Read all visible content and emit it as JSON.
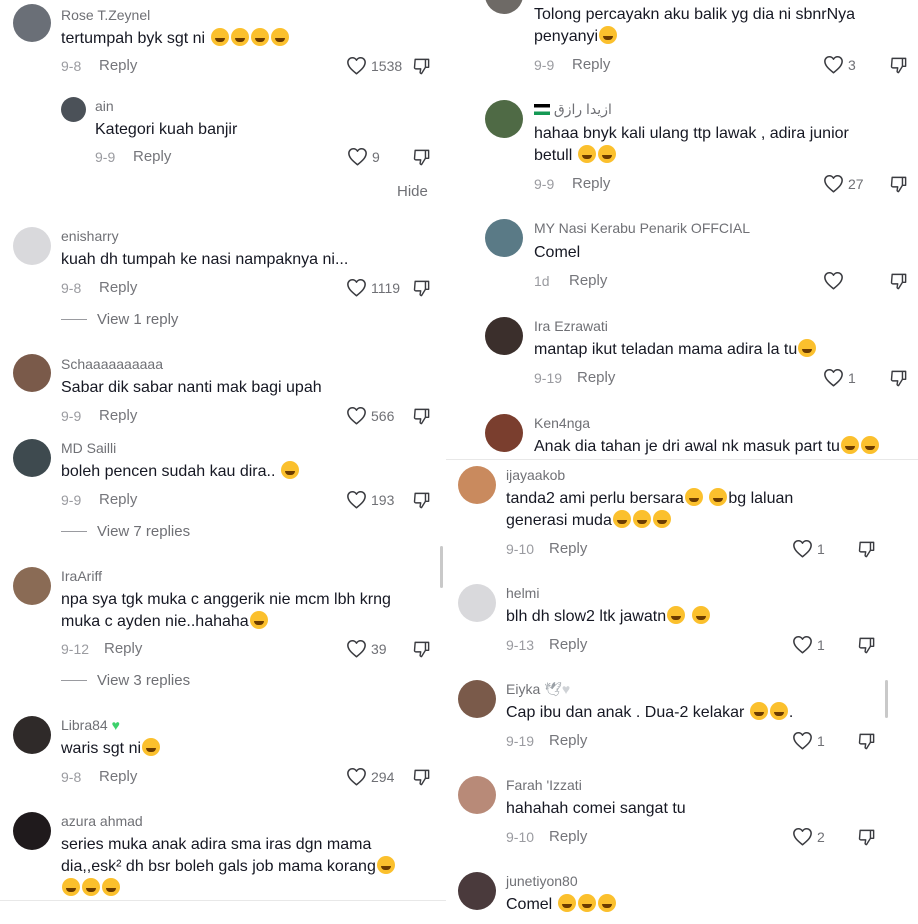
{
  "left": {
    "comments": [
      {
        "user": "Rose T.Zeynel",
        "text": "tertumpah byk sgt ni",
        "emojis": 4,
        "date": "9-8",
        "reply": "Reply",
        "likes": "1538"
      },
      {
        "user": "ain",
        "text": "Kategori kuah banjir",
        "date": "9-9",
        "reply": "Reply",
        "likes": "9"
      },
      {
        "user": "enisharry",
        "text": "kuah dh tumpah ke nasi nampaknya ni...",
        "date": "9-8",
        "reply": "Reply",
        "likes": "1119",
        "view": "View 1 reply"
      },
      {
        "user": "Schaaaaaaaaaa",
        "text": "Sabar dik sabar nanti mak bagi upah",
        "date": "9-9",
        "reply": "Reply",
        "likes": "566"
      },
      {
        "user": "MD Sailli",
        "text": "boleh pencen sudah kau dira..",
        "date": "9-9",
        "reply": "Reply",
        "likes": "193",
        "view": "View 7 replies"
      },
      {
        "user": "IraAriff",
        "text1": "npa sya tgk muka c anggerik nie mcm lbh krng",
        "text2": "muka c ayden nie..hahaha",
        "date": "9-12",
        "reply": "Reply",
        "likes": "39",
        "view": "View 3 replies"
      },
      {
        "user": "Libra84",
        "text": "waris sgt ni",
        "date": "9-8",
        "reply": "Reply",
        "likes": "294"
      },
      {
        "user": "azura ahmad",
        "text1": "series muka anak adira sma iras dgn mama",
        "text2": "dia,,esk² dh bsr boleh gals job mama korang"
      }
    ],
    "hide": "Hide"
  },
  "right1": {
    "comments": [
      {
        "text1": "Tolong percayakn aku balik yg dia ni sbnrNya",
        "text2": "penyanyi",
        "date": "9-9",
        "reply": "Reply",
        "likes": "3"
      },
      {
        "user": "ازيدا رازق",
        "text1": "hahaa bnyk kali ulang ttp lawak , adira junior",
        "text2": "betull",
        "date": "9-9",
        "reply": "Reply",
        "likes": "27"
      },
      {
        "user": "MY Nasi Kerabu Penarik OFFCIAL",
        "text": "Comel",
        "date": "1d",
        "reply": "Reply",
        "likes": ""
      },
      {
        "user": "Ira Ezrawati",
        "text": "mantap ikut teladan mama adira la tu",
        "date": "9-19",
        "reply": "Reply",
        "likes": "1"
      },
      {
        "user": "Ken4nga",
        "text": "Anak dia tahan je dri awal nk masuk part tu"
      }
    ]
  },
  "right2": {
    "comments": [
      {
        "user": "ijayaakob",
        "text1": "tanda2 ami perlu bersara",
        "text1b": "bg laluan",
        "text2": "generasi muda",
        "date": "9-10",
        "reply": "Reply",
        "likes": "1"
      },
      {
        "user": "helmi",
        "text": "blh dh slow2 ltk jawatn",
        "date": "9-13",
        "reply": "Reply",
        "likes": "1"
      },
      {
        "user": "Eiyka",
        "text": "Cap ibu dan anak . Dua-2 kelakar",
        "text_end": ".",
        "date": "9-19",
        "reply": "Reply",
        "likes": "1"
      },
      {
        "user": "Farah 'Izzati",
        "text": "hahahah comei sangat tu",
        "date": "9-10",
        "reply": "Reply",
        "likes": "2"
      },
      {
        "user": "junetiyon80",
        "text": "Comel"
      }
    ]
  },
  "colors": {
    "username": "#6f7075",
    "text": "#161823",
    "meta": "#9a9ba0",
    "emoji": "#fbc02d",
    "heart-green": "#3dd16b"
  }
}
